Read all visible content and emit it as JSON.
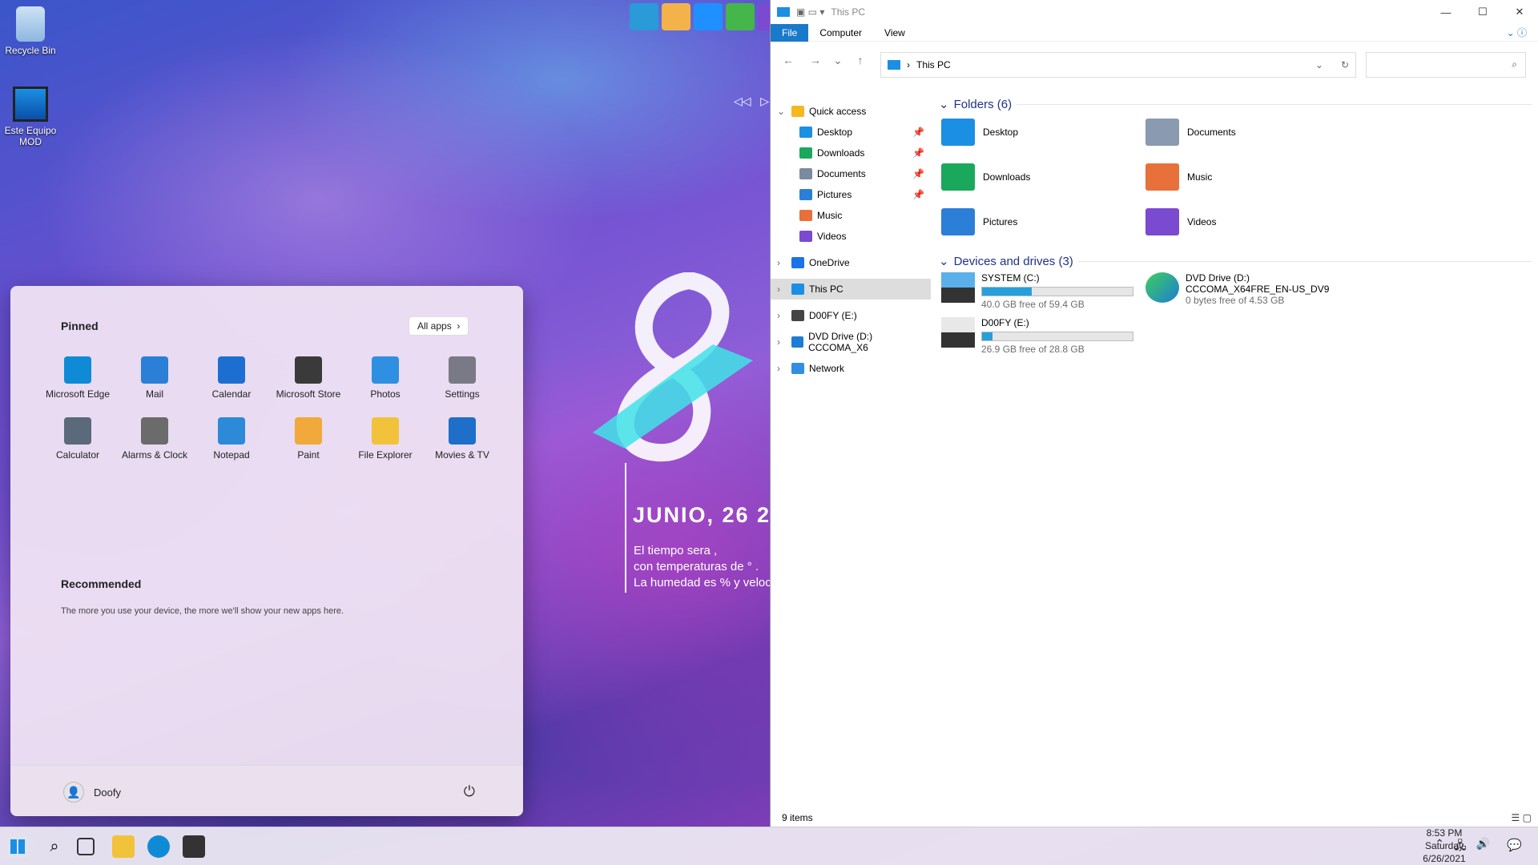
{
  "desktop": {
    "icons": [
      {
        "label": "Recycle Bin"
      },
      {
        "label": "Este Equipo MOD"
      }
    ]
  },
  "widget": {
    "date": "JUNIO, 26 2",
    "line1": "El tiempo sera ,",
    "line2": "con temperaturas de ° .",
    "line3": "La humedad es  % y veloci"
  },
  "start": {
    "pinned_title": "Pinned",
    "all_apps": "All apps",
    "apps": [
      {
        "label": "Microsoft Edge",
        "icon": "edge-icon",
        "color": "#0f8bd6"
      },
      {
        "label": "Mail",
        "icon": "mail-icon",
        "color": "#2b7fd6"
      },
      {
        "label": "Calendar",
        "icon": "calendar-icon",
        "color": "#1c6fd1"
      },
      {
        "label": "Microsoft Store",
        "icon": "store-icon",
        "color": "#3a3a3a"
      },
      {
        "label": "Photos",
        "icon": "photos-icon",
        "color": "#2f8fe0"
      },
      {
        "label": "Settings",
        "icon": "settings-icon",
        "color": "#7a7a86"
      },
      {
        "label": "Calculator",
        "icon": "calculator-icon",
        "color": "#5a6a7a"
      },
      {
        "label": "Alarms & Clock",
        "icon": "clock-icon",
        "color": "#6b6b6b"
      },
      {
        "label": "Notepad",
        "icon": "notepad-icon",
        "color": "#2c8ad8"
      },
      {
        "label": "Paint",
        "icon": "paint-icon",
        "color": "#f0a93a"
      },
      {
        "label": "File Explorer",
        "icon": "file-explorer-icon",
        "color": "#f2c23a"
      },
      {
        "label": "Movies & TV",
        "icon": "movies-icon",
        "color": "#1d6fc9"
      }
    ],
    "recommended_title": "Recommended",
    "recommended_text": "The more you use your device, the more we'll show your new apps here.",
    "user": "Doofy"
  },
  "explorer": {
    "title": "This PC",
    "ribbon": [
      "File",
      "Computer",
      "View"
    ],
    "address": "This PC",
    "nav": [
      {
        "label": "Quick access",
        "indent": 0
      },
      {
        "label": "Desktop",
        "indent": 1,
        "pinned": true
      },
      {
        "label": "Downloads",
        "indent": 1,
        "pinned": true
      },
      {
        "label": "Documents",
        "indent": 1,
        "pinned": true
      },
      {
        "label": "Pictures",
        "indent": 1,
        "pinned": true
      },
      {
        "label": "Music",
        "indent": 1
      },
      {
        "label": "Videos",
        "indent": 1
      },
      {
        "label": "OneDrive",
        "indent": 0
      },
      {
        "label": "This PC",
        "indent": 0,
        "selected": true
      },
      {
        "label": "D00FY (E:)",
        "indent": 0
      },
      {
        "label": "DVD Drive (D:) CCCOMA_X6",
        "indent": 0
      },
      {
        "label": "Network",
        "indent": 0
      }
    ],
    "folders_title": "Folders (6)",
    "folders": [
      "Desktop",
      "Documents",
      "Downloads",
      "Music",
      "Pictures",
      "Videos"
    ],
    "drives_title": "Devices and drives (3)",
    "drives": [
      {
        "name": "SYSTEM (C:)",
        "free": "40.0 GB free of 59.4 GB",
        "used": 0.33
      },
      {
        "name": "DVD Drive (D:)",
        "line2": "CCCOMA_X64FRE_EN-US_DV9",
        "free": "0 bytes free of 4.53 GB"
      },
      {
        "name": "D00FY (E:)",
        "free": "26.9 GB free of 28.8 GB",
        "used": 0.07
      }
    ],
    "status": "9 items"
  },
  "clock": {
    "time": "8:53 PM",
    "day": "Saturday",
    "date": "6/26/2021"
  }
}
